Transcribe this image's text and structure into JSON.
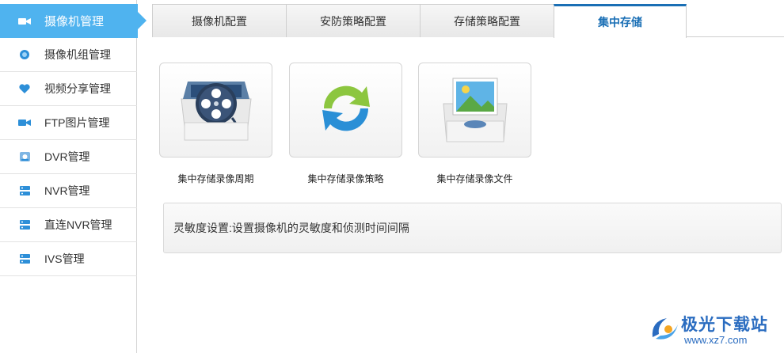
{
  "sidebar": {
    "active": {
      "label": "摄像机管理",
      "icon": "camera-icon"
    },
    "items": [
      {
        "label": "摄像机组管理",
        "icon": "camera-group-icon"
      },
      {
        "label": "视频分享管理",
        "icon": "heart-icon"
      },
      {
        "label": "FTP图片管理",
        "icon": "camera-icon"
      },
      {
        "label": "DVR管理",
        "icon": "dvr-icon"
      },
      {
        "label": "NVR管理",
        "icon": "nvr-icon"
      },
      {
        "label": "直连NVR管理",
        "icon": "nvr-icon"
      },
      {
        "label": "IVS管理",
        "icon": "ivs-icon"
      }
    ]
  },
  "tabs": [
    {
      "label": "摄像机配置"
    },
    {
      "label": "安防策略配置"
    },
    {
      "label": "存储策略配置"
    },
    {
      "label": "集中存储",
      "active": true
    }
  ],
  "tiles": [
    {
      "label": "集中存储录像周期",
      "icon": "film-reel-icon"
    },
    {
      "label": "集中存储录像策略",
      "icon": "sync-arrows-icon"
    },
    {
      "label": "集中存储录像文件",
      "icon": "picture-file-icon"
    }
  ],
  "info": {
    "text": "灵敏度设置:设置摄像机的灵敏度和侦测时间间隔"
  },
  "watermark": {
    "brand": "极光下载站",
    "url": "www.xz7.com"
  },
  "colors": {
    "accent": "#4fb3ef",
    "tab_active": "#1a6fb5",
    "watermark": "#2a6cc0"
  }
}
